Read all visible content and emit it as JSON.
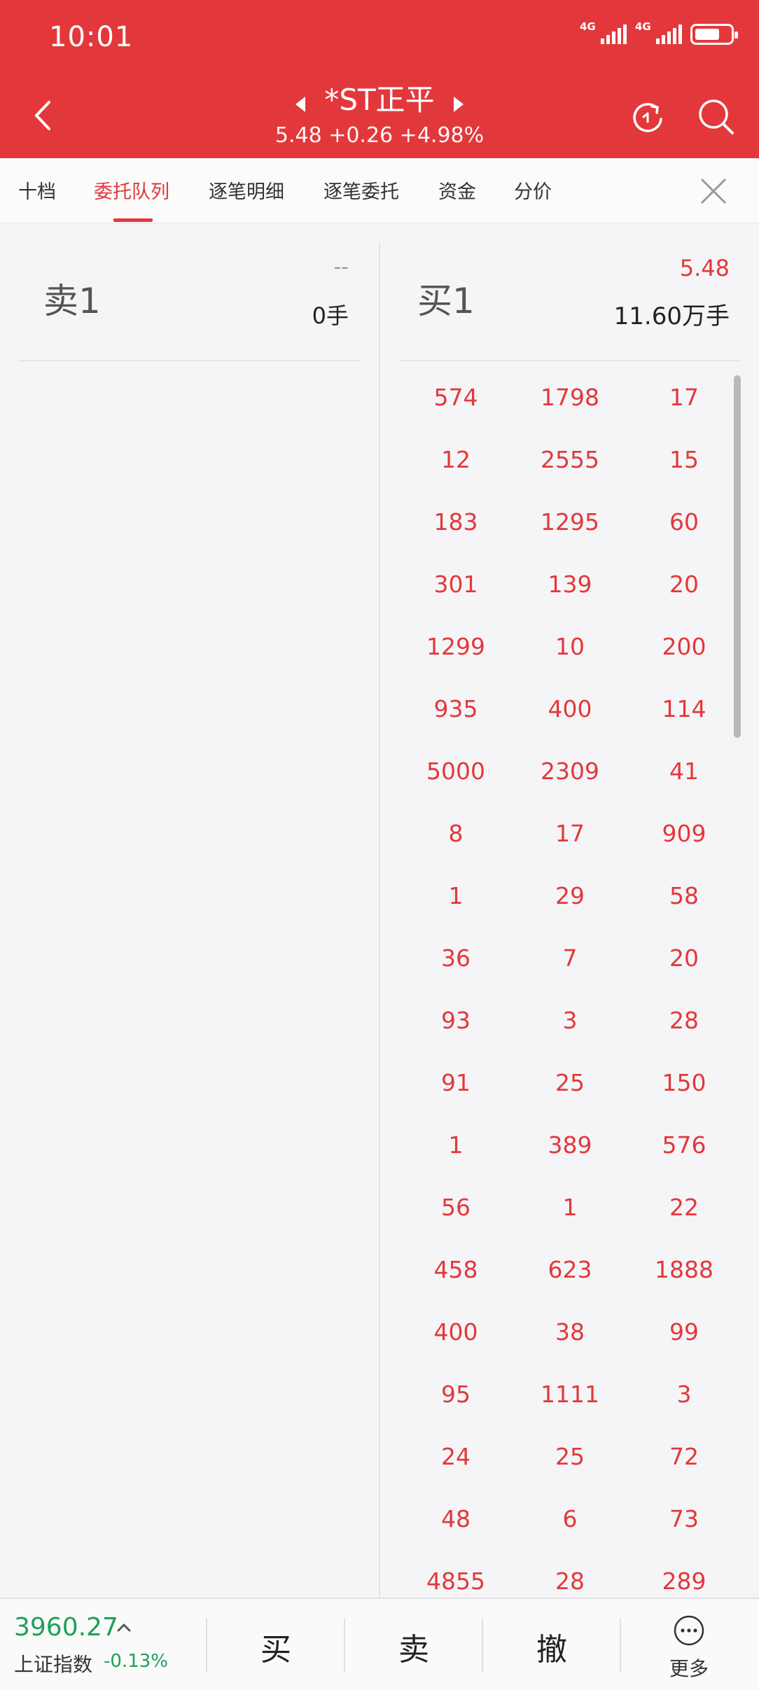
{
  "status_bar": {
    "time": "10:01",
    "net1": "4G",
    "net2": "4G"
  },
  "header": {
    "stock_name": "*ST正平",
    "price_line": "5.48 +0.26 +4.98%"
  },
  "tabs": [
    "十档",
    "委托队列",
    "逐笔明细",
    "逐笔委托",
    "资金",
    "分价"
  ],
  "active_tab": 1,
  "sell": {
    "label": "卖1",
    "price": "--",
    "volume": "0手"
  },
  "buy": {
    "label": "买1",
    "price": "5.48",
    "volume": "11.60万手"
  },
  "queue_rows": [
    [
      "574",
      "1798",
      "17"
    ],
    [
      "12",
      "2555",
      "15"
    ],
    [
      "183",
      "1295",
      "60"
    ],
    [
      "301",
      "139",
      "20"
    ],
    [
      "1299",
      "10",
      "200"
    ],
    [
      "935",
      "400",
      "114"
    ],
    [
      "5000",
      "2309",
      "41"
    ],
    [
      "8",
      "17",
      "909"
    ],
    [
      "1",
      "29",
      "58"
    ],
    [
      "36",
      "7",
      "20"
    ],
    [
      "93",
      "3",
      "28"
    ],
    [
      "91",
      "25",
      "150"
    ],
    [
      "1",
      "389",
      "576"
    ],
    [
      "56",
      "1",
      "22"
    ],
    [
      "458",
      "623",
      "1888"
    ],
    [
      "400",
      "38",
      "99"
    ],
    [
      "95",
      "1111",
      "3"
    ],
    [
      "24",
      "25",
      "72"
    ],
    [
      "48",
      "6",
      "73"
    ],
    [
      "4855",
      "28",
      "289"
    ]
  ],
  "bottom": {
    "index_value": "3960.27",
    "index_name": "上证指数",
    "index_change": "-0.13%",
    "buy": "买",
    "sell": "卖",
    "cancel": "撤",
    "more": "更多"
  },
  "colors": {
    "brand_red": "#e3383b",
    "up": "#e3383b",
    "down": "#1fa05a"
  }
}
